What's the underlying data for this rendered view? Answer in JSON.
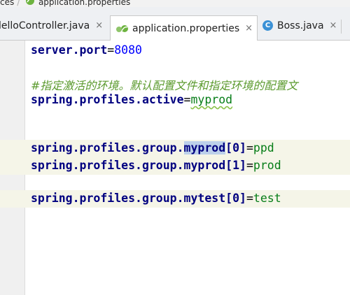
{
  "breadcrumb": {
    "items": [
      "ces",
      "application.properties"
    ]
  },
  "tabs": [
    {
      "label": "lelloController.java",
      "close": "×",
      "active": false
    },
    {
      "label": "application.properties",
      "close": "×",
      "active": true
    },
    {
      "label": "Boss.java",
      "close": "×",
      "active": false
    }
  ],
  "editor": {
    "line1": {
      "key": "server.port",
      "eq": "=",
      "value": "8080"
    },
    "comment": "#指定激活的环境。默认配置文件和指定环境的配置文",
    "line3": {
      "key": "spring.profiles.active",
      "eq": "=",
      "value": "myprod"
    },
    "line5": {
      "key_prefix": "spring.profiles.group.",
      "key_word": "myprod",
      "index": "[0]",
      "eq": "=",
      "value": "ppd"
    },
    "line6": {
      "key": "spring.profiles.group.myprod",
      "index": "[1]",
      "eq": "=",
      "value": "prod"
    },
    "line8": {
      "key": "spring.profiles.group.mytest",
      "index": "[0]",
      "eq": "=",
      "value": "test"
    }
  },
  "colors": {
    "key": "#000080",
    "value": "#067d17",
    "number": "#0000ff",
    "comment": "#5b9a2e",
    "selection": "#bcd0ea"
  },
  "icons": {
    "class_letter": "C"
  }
}
